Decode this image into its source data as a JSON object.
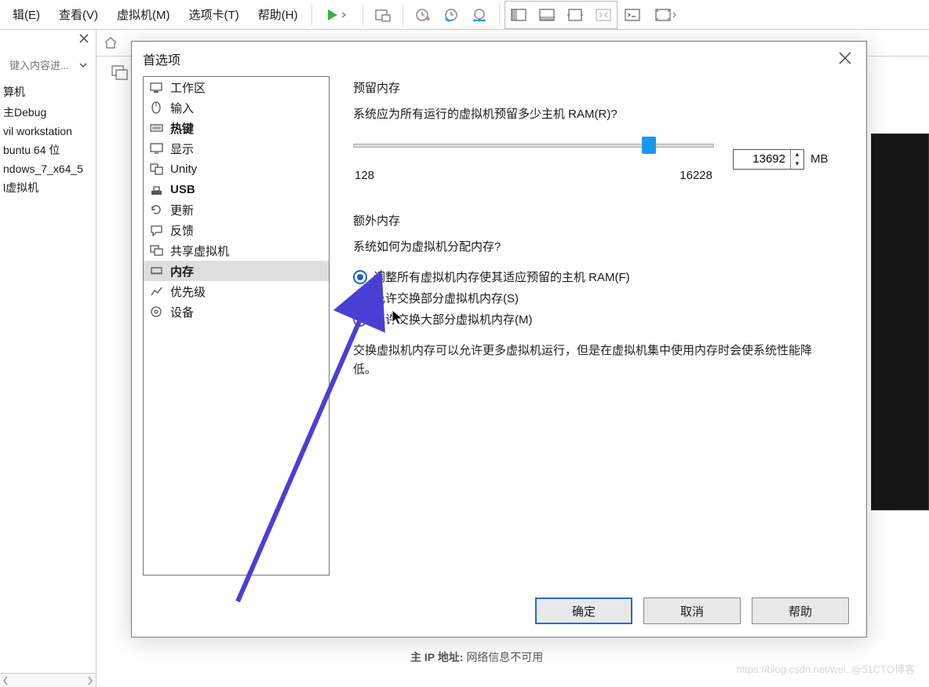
{
  "menu": {
    "edit": "辑(E)",
    "view": "查看(V)",
    "vm": "虚拟机(M)",
    "tabs": "选项卡(T)",
    "help": "帮助(H)"
  },
  "sidebar": {
    "search_placeholder": "键入内容进...",
    "items": [
      "算机",
      "主Debug",
      "vil workstation",
      "buntu 64 位",
      "ndows_7_x64_5",
      "l虚拟机"
    ]
  },
  "vm_info_label": "主 IP 地址:",
  "vm_info_value": "网络信息不可用",
  "watermark": "https://blog.csdn.net/wei..@51CTO博客",
  "dialog": {
    "title": "首选项",
    "categories": [
      {
        "label": "工作区",
        "icon": "workspace"
      },
      {
        "label": "输入",
        "icon": "mouse"
      },
      {
        "label": "热键",
        "icon": "keyboard",
        "bold": true
      },
      {
        "label": "显示",
        "icon": "monitor"
      },
      {
        "label": "Unity",
        "icon": "unity"
      },
      {
        "label": "USB",
        "icon": "usb",
        "bold": true
      },
      {
        "label": "更新",
        "icon": "refresh"
      },
      {
        "label": "反馈",
        "icon": "feedback"
      },
      {
        "label": "共享虚拟机",
        "icon": "share"
      },
      {
        "label": "内存",
        "icon": "memory",
        "bold": true,
        "selected": true
      },
      {
        "label": "优先级",
        "icon": "priority"
      },
      {
        "label": "设备",
        "icon": "devices"
      }
    ],
    "reserved": {
      "title": "预留内存",
      "question": "系统应为所有运行的虚拟机预留多少主机 RAM(R)?",
      "min": "128",
      "max": "16228",
      "value": "13692",
      "unit": "MB",
      "slider_pct": 82
    },
    "extra": {
      "title": "额外内存",
      "question": "系统如何为虚拟机分配内存?",
      "options": [
        "调整所有虚拟机内存使其适应预留的主机 RAM(F)",
        "允许交换部分虚拟机内存(S)",
        "允许交换大部分虚拟机内存(M)"
      ],
      "selected": 0,
      "hint": "交换虚拟机内存可以允许更多虚拟机运行，但是在虚拟机集中使用内存时会使系统性能降低。"
    },
    "buttons": {
      "ok": "确定",
      "cancel": "取消",
      "help": "帮助"
    }
  }
}
